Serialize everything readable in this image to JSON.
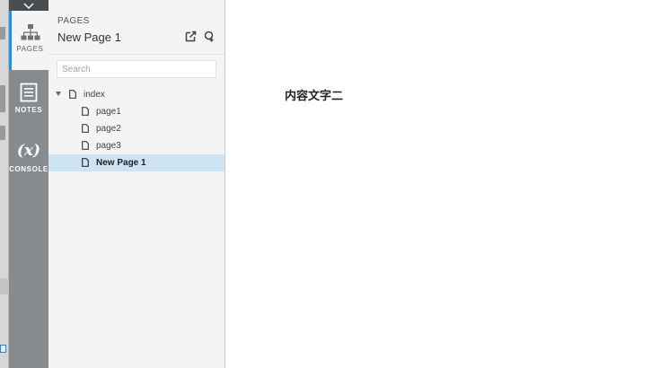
{
  "rail": {
    "pages_label": "PAGES",
    "notes_label": "NOTES",
    "console_label": "CONSOLE",
    "console_glyph": "(x)"
  },
  "panel": {
    "caption": "PAGES",
    "title": "New Page 1",
    "search_placeholder": "Search",
    "actions": [
      "add-page-icon",
      "add-folder-icon"
    ]
  },
  "tree": {
    "root": {
      "label": "index",
      "expanded": true
    },
    "children": [
      {
        "label": "page1",
        "selected": false
      },
      {
        "label": "page2",
        "selected": false
      },
      {
        "label": "page3",
        "selected": false
      },
      {
        "label": "New Page 1",
        "selected": true
      }
    ]
  },
  "canvas": {
    "text": "内容文字二"
  },
  "colors": {
    "accent": "#2e8ddc",
    "rail": "#888b8d",
    "selected_row": "#cde4f4"
  }
}
